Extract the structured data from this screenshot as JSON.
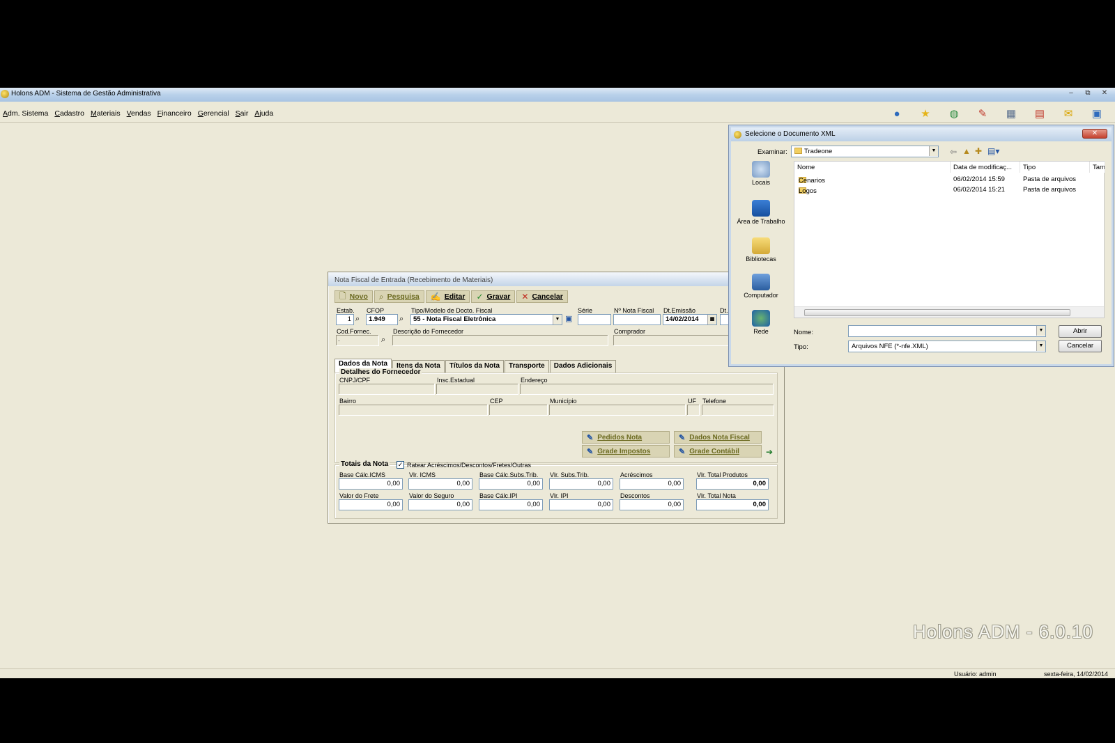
{
  "window": {
    "title": "Holons ADM - Sistema de Gestão Administrativa",
    "min": "▭",
    "max": "⧉",
    "close": "✕"
  },
  "menu": [
    "Adm. Sistema",
    "Cadastro",
    "Materiais",
    "Vendas",
    "Financeiro",
    "Gerencial",
    "Sair",
    "Ajuda"
  ],
  "toolbar_icons": [
    "user-icon",
    "star-icon",
    "globe-icon",
    "checklist-icon",
    "calculator-icon",
    "calendar-icon",
    "xml-icon",
    "window-icon"
  ],
  "version_text": "Holons ADM - 6.0.10",
  "status": {
    "user": "Usuário: admin",
    "date": "sexta-feira, 14/02/2014"
  },
  "nota": {
    "title": "Nota Fiscal de Entrada (Recebimento de Materiais)",
    "buttons": {
      "novo": "Novo",
      "pesquisa": "Pesquisa",
      "editar": "Editar",
      "gravar": "Gravar",
      "cancelar": "Cancelar"
    },
    "labels": {
      "estab": "Estab.",
      "cfop": "CFOP",
      "tipo": "Tipo/Modelo de Docto. Fiscal",
      "serie": "Série",
      "num": "Nº Nota Fiscal",
      "emissao": "Dt.Emissão",
      "dt": "Dt.",
      "cod_fornec": "Cod.Fornec.",
      "desc_fornec": "Descrição do Fornecedor",
      "comprador": "Comprador"
    },
    "values": {
      "estab": "1",
      "cfop": "1.949",
      "tipo": "55 - Nota Fiscal Eletrônica",
      "serie": "",
      "num": "",
      "emissao": "14/02/2014",
      "cod_fornec": ".",
      "desc_fornec": "",
      "comprador": ""
    },
    "tabs": [
      "Dados da Nota",
      "Itens da Nota",
      "Títulos da Nota",
      "Transporte",
      "Dados Adicionais"
    ],
    "fornecedor": {
      "title": "Detalhes do Fornecedor",
      "cnpj": "CNPJ/CPF",
      "insc": "Insc.Estadual",
      "endereco": "Endereço",
      "bairro": "Bairro",
      "cep": "CEP",
      "municipio": "Município",
      "uf": "UF",
      "telefone": "Telefone"
    },
    "action_buttons": {
      "pedidos": "Pedidos Nota",
      "dados_nf": "Dados Nota Fiscal",
      "impostos": "Grade Impostos",
      "contabil": "Grade Contábil"
    },
    "totais": {
      "title": "Totais da Nota",
      "ratear": "Ratear Acréscimos/Descontos/Fretes/Outras",
      "check_mark": "✓",
      "row1": [
        {
          "label": "Base Cálc.ICMS",
          "value": "0,00"
        },
        {
          "label": "Vlr. ICMS",
          "value": "0,00"
        },
        {
          "label": "Base Cálc.Subs.Trib.",
          "value": "0,00"
        },
        {
          "label": "Vlr. Subs.Trib.",
          "value": "0,00"
        },
        {
          "label": "Acréscimos",
          "value": "0,00"
        },
        {
          "label": "Vlr. Total Produtos",
          "value": "0,00"
        }
      ],
      "row2": [
        {
          "label": "Valor do Frete",
          "value": "0,00"
        },
        {
          "label": "Valor do Seguro",
          "value": "0,00"
        },
        {
          "label": "Base Cálc.IPI",
          "value": "0,00"
        },
        {
          "label": "Vlr. IPI",
          "value": "0,00"
        },
        {
          "label": "Descontos",
          "value": "0,00"
        },
        {
          "label": "Vlr. Total Nota",
          "value": "0,00"
        }
      ]
    }
  },
  "dialog": {
    "title": "Selecione o Documento XML",
    "close": "✕",
    "examinar_label": "Examinar:",
    "examinar_value": "Tradeone",
    "places": [
      "Locais",
      "Área de Trabalho",
      "Bibliotecas",
      "Computador",
      "Rede"
    ],
    "columns": [
      "Nome",
      "Data de modificaç...",
      "Tipo",
      "Tam"
    ],
    "files": [
      {
        "name": "Cenarios",
        "date": "06/02/2014 15:59",
        "type": "Pasta de arquivos"
      },
      {
        "name": "Logos",
        "date": "06/02/2014 15:21",
        "type": "Pasta de arquivos"
      }
    ],
    "nome_label": "Nome:",
    "nome_value": "",
    "tipo_label": "Tipo:",
    "tipo_value": "Arquivos NFE (*-nfe.XML)",
    "abrir": "Abrir",
    "cancelar": "Cancelar"
  }
}
